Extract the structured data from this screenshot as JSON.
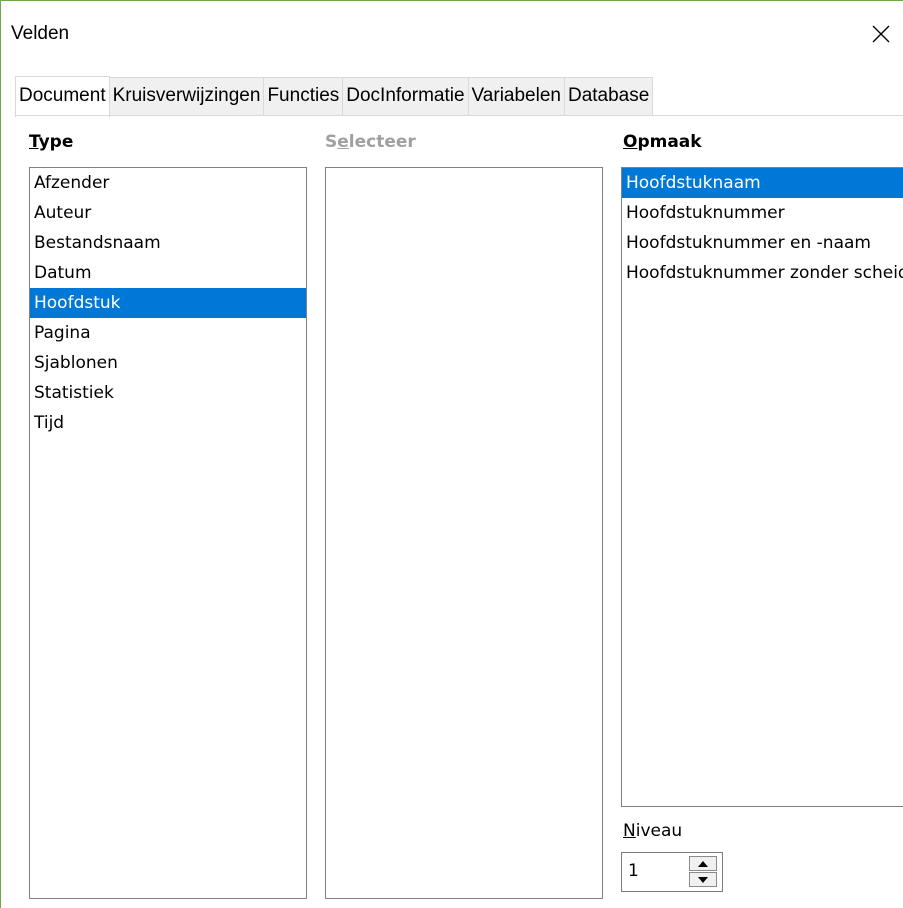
{
  "window": {
    "title": "Velden",
    "close_icon": "close-icon"
  },
  "tabs": [
    {
      "label": "Document",
      "active": true
    },
    {
      "label": "Kruisverwijzingen",
      "active": false
    },
    {
      "label": "Functies",
      "active": false
    },
    {
      "label": "DocInformatie",
      "active": false
    },
    {
      "label": "Variabelen",
      "active": false
    },
    {
      "label": "Database",
      "active": false
    }
  ],
  "type_column": {
    "label_underlined": "T",
    "label_rest": "ype",
    "items": [
      "Afzender",
      "Auteur",
      "Bestandsnaam",
      "Datum",
      "Hoofdstuk",
      "Pagina",
      "Sjablonen",
      "Statistiek",
      "Tijd"
    ],
    "selected": "Hoofdstuk"
  },
  "select_column": {
    "label_first": "S",
    "label_underlined": "e",
    "label_rest": "lecteer",
    "items": []
  },
  "format_column": {
    "label_underlined": "O",
    "label_rest": "pmaak",
    "items": [
      "Hoofdstuknaam",
      "Hoofdstuknummer",
      "Hoofdstuknummer en -naam",
      "Hoofdstuknummer zonder scheidingsteken"
    ],
    "selected": "Hoofdstuknaam"
  },
  "niveau": {
    "label_underlined": "N",
    "label_rest": "iveau",
    "value": "1"
  },
  "colors": {
    "selection": "#0078d7",
    "accent_border": "#6aa84f"
  }
}
